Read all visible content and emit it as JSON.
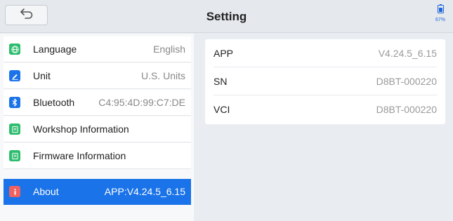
{
  "header": {
    "title": "Setting",
    "battery_level": "67%"
  },
  "sidebar": {
    "items": [
      {
        "label": "Language",
        "value": "English",
        "icon": "globe-icon",
        "color": "#2dbd6e"
      },
      {
        "label": "Unit",
        "value": "U.S. Units",
        "icon": "pencil-icon",
        "color": "#1a73e8"
      },
      {
        "label": "Bluetooth",
        "value": "C4:95:4D:99:C7:DE",
        "icon": "bluetooth-icon",
        "color": "#1a73e8"
      },
      {
        "label": "Workshop Information",
        "value": "",
        "icon": "document-icon",
        "color": "#2dbd6e"
      },
      {
        "label": "Firmware Information",
        "value": "",
        "icon": "document-icon",
        "color": "#2dbd6e"
      },
      {
        "label": "About",
        "value": "APP:V4.24.5_6.15",
        "icon": "info-icon",
        "color": "#f06262",
        "active": true
      }
    ]
  },
  "about": {
    "rows": [
      {
        "label": "APP",
        "value": "V4.24.5_6.15"
      },
      {
        "label": "SN",
        "value": "D8BT-000220"
      },
      {
        "label": "VCI",
        "value": "D8BT-000220"
      }
    ]
  },
  "colors": {
    "accent": "#1a73e8",
    "background": "#e9edf2",
    "topbar": "#e5e8ec"
  }
}
